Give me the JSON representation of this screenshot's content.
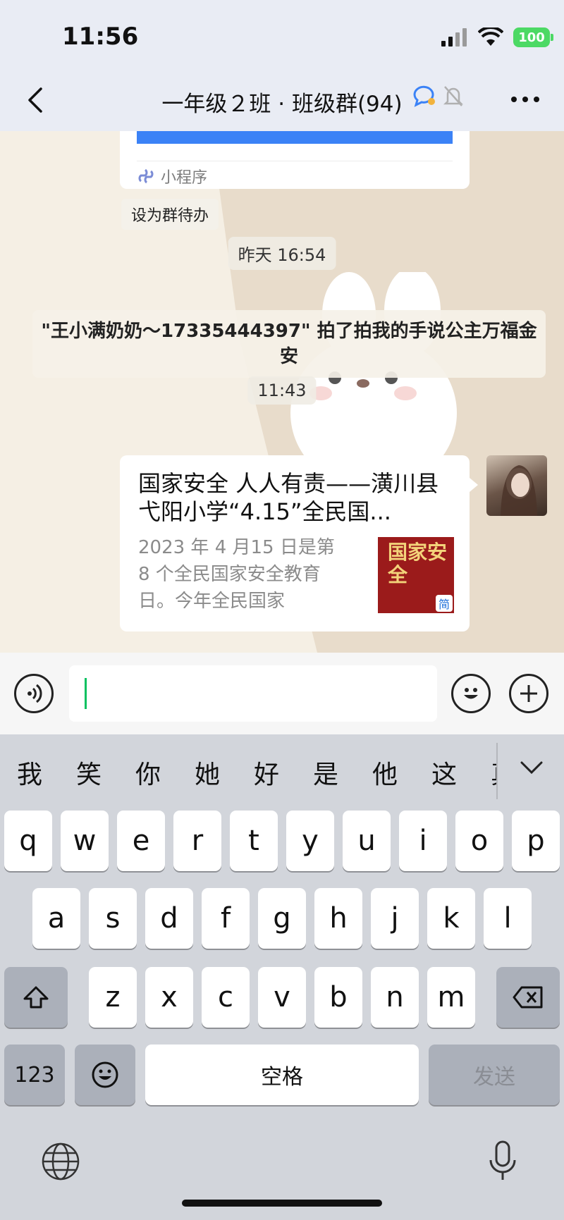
{
  "status_bar": {
    "time": "11:56",
    "battery": "100"
  },
  "header": {
    "title": "一年级２班 · 班级群(94)"
  },
  "chat": {
    "mini_program_label": "小程序",
    "todo_label": "设为群待办",
    "timestamp_1": "昨天 16:54",
    "system_message": "\"王小满奶奶～17335444397\" 拍了拍我的手说公主万福金安",
    "timestamp_2": "11:43",
    "article": {
      "title": "国家安全 人人有责——潢川县弋阳小学“4.15”全民国...",
      "description": "2023 年 4 月15 日是第 8 个全民国家安全教育日。今年全民国家",
      "thumb_text": "国家安全",
      "thumb_badge": "简"
    }
  },
  "keyboard": {
    "candidates": [
      "我",
      "笑",
      "你",
      "她",
      "好",
      "是",
      "他",
      "这",
      "真"
    ],
    "row1": [
      "q",
      "w",
      "e",
      "r",
      "t",
      "y",
      "u",
      "i",
      "o",
      "p"
    ],
    "row2": [
      "a",
      "s",
      "d",
      "f",
      "g",
      "h",
      "j",
      "k",
      "l"
    ],
    "row3": [
      "z",
      "x",
      "c",
      "v",
      "b",
      "n",
      "m"
    ],
    "numbers_label": "123",
    "space_label": "空格",
    "send_label": "发送"
  },
  "colors": {
    "accent_green": "#07c160",
    "link_blue": "#3b82f6",
    "battery_green": "#4cd964"
  }
}
